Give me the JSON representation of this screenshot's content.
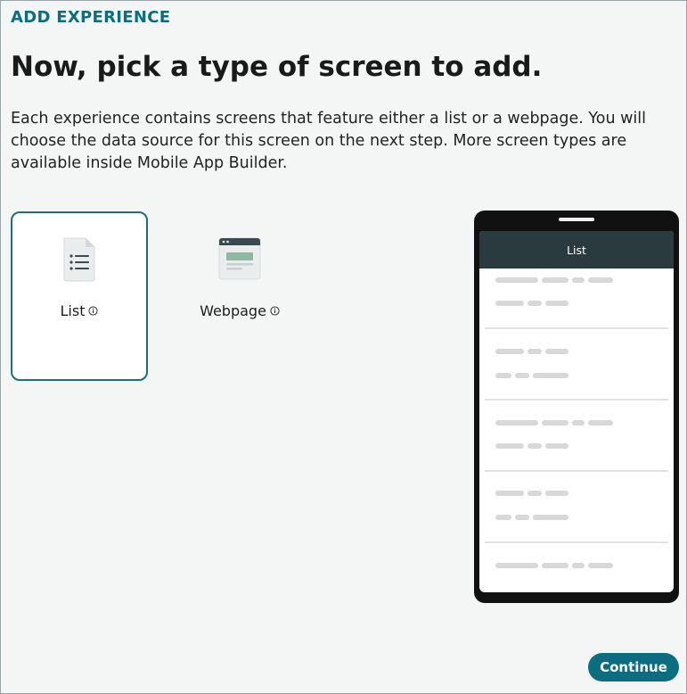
{
  "eyebrow": "ADD EXPERIENCE",
  "heading": "Now, pick a type of screen to add.",
  "description": "Each experience contains screens that feature either a list or a webpage. You will choose the data source for this screen on the next step. More screen types are available inside Mobile App Builder.",
  "options": [
    {
      "label": "List",
      "icon": "document-list-icon",
      "selected": true
    },
    {
      "label": "Webpage",
      "icon": "browser-window-icon",
      "selected": false
    }
  ],
  "preview": {
    "header_title": "List"
  },
  "actions": {
    "continue_label": "Continue"
  },
  "colors": {
    "accent": "#0b6e80",
    "preview_header": "#2a3b3f",
    "background": "#f4f6f6"
  }
}
